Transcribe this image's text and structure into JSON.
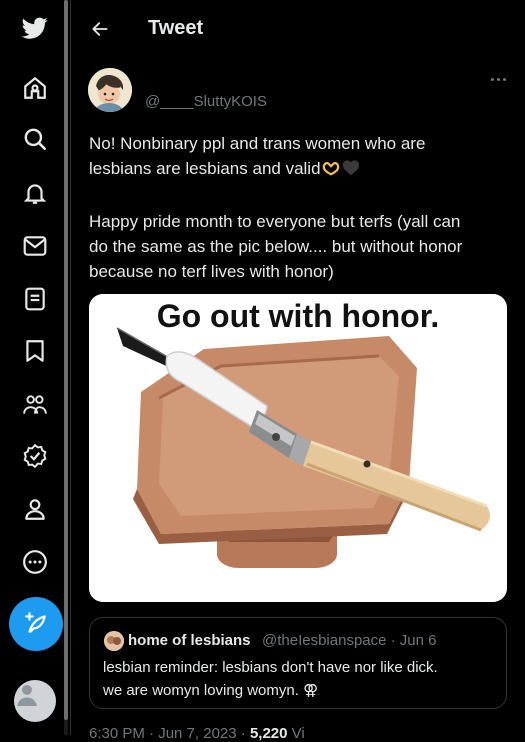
{
  "header": {
    "title": "Tweet"
  },
  "tweet": {
    "handle": "@____SluttyKOIS",
    "text_line1": "No! Nonbinary ppl and trans women who are",
    "text_line2": "lesbians are lesbians and valid",
    "text_para2": "Happy pride month to everyone but terfs (yall can\ndo the same as the pic below.... but without honor\nbecause no terf lives with honor)",
    "emoji_icons": [
      "heart-hands-icon",
      "black-heart-icon"
    ]
  },
  "media": {
    "caption": "Go out with honor."
  },
  "quote": {
    "name": "home of lesbians",
    "handle": "@theIesbianspace · Jun 6",
    "text": "lesbian reminder: lesbians don't have nor like dick.\nwe are womyn loving womyn. ⚢"
  },
  "meta": {
    "time": "6:30 PM · Jun 7, 2023 ·",
    "views": "5,220",
    "views_label": "Vi"
  },
  "sidebar": {
    "items": [
      {
        "icon": "twitter-logo-icon"
      },
      {
        "icon": "home-icon"
      },
      {
        "icon": "search-icon"
      },
      {
        "icon": "notifications-icon"
      },
      {
        "icon": "messages-icon"
      },
      {
        "icon": "lists-icon"
      },
      {
        "icon": "bookmarks-icon"
      },
      {
        "icon": "communities-icon"
      },
      {
        "icon": "verified-icon"
      },
      {
        "icon": "profile-icon"
      },
      {
        "icon": "more-icon"
      }
    ]
  },
  "colors": {
    "accent": "#1d9bf0",
    "background": "#000000",
    "text": "#e7e9ea",
    "muted": "#71767b",
    "border": "#2f3336"
  }
}
